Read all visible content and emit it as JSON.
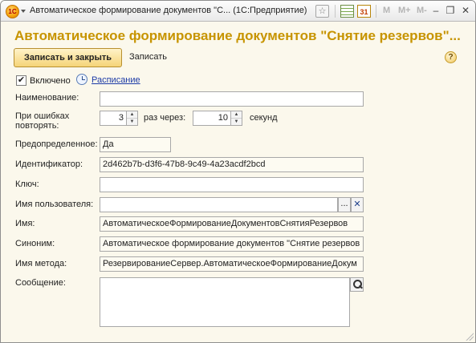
{
  "window": {
    "title": "Автоматическое формирование документов \"С...  (1С:Предприятие)",
    "logo_text": "1С",
    "star_glyph": "☆",
    "calendar_text": "31",
    "mem_buttons": [
      "M",
      "M+",
      "M-"
    ],
    "controls": {
      "minimize": "–",
      "restore": "❐",
      "close": "✕"
    }
  },
  "form": {
    "heading": "Автоматическое формирование документов \"Снятие резервов\"...",
    "save_close_label": "Записать и закрыть",
    "save_label": "Записать",
    "help_glyph": "?"
  },
  "enabled": {
    "label": "Включено",
    "checked": true,
    "check_glyph": "✔"
  },
  "schedule_link": "Расписание",
  "fields": {
    "name": {
      "label": "Наименование:",
      "value": ""
    },
    "retry": {
      "label_line1": "При ошибках",
      "label_line2": "повторять:",
      "count": "3",
      "times_label": "раз  через:",
      "interval": "10",
      "seconds_label": "секунд"
    },
    "predefined": {
      "label": "Предопределенное:",
      "value": "Да"
    },
    "id": {
      "label": "Идентификатор:",
      "value": "2d462b7b-d3f6-47b8-9c49-4a23acdf2bcd"
    },
    "key": {
      "label": "Ключ:",
      "value": ""
    },
    "user": {
      "label": "Имя пользователя:",
      "value": "",
      "choose_glyph": "...",
      "clear_glyph": "✕"
    },
    "job_name": {
      "label": "Имя:",
      "value": "АвтоматическоеФормированиеДокументовСнятияРезервов"
    },
    "synonym": {
      "label": "Синоним:",
      "value": "Автоматическое формирование документов \"Снятие резервов"
    },
    "method": {
      "label": "Имя метода:",
      "value": "РезервированиеСервер.АвтоматическоеФормированиеДокум"
    },
    "message": {
      "label": "Сообщение:",
      "value": ""
    }
  },
  "colors": {
    "heading": "#c79400",
    "primary_button": "#f5d478",
    "link": "#1c3aa6",
    "form_background": "#fbf8ec"
  }
}
